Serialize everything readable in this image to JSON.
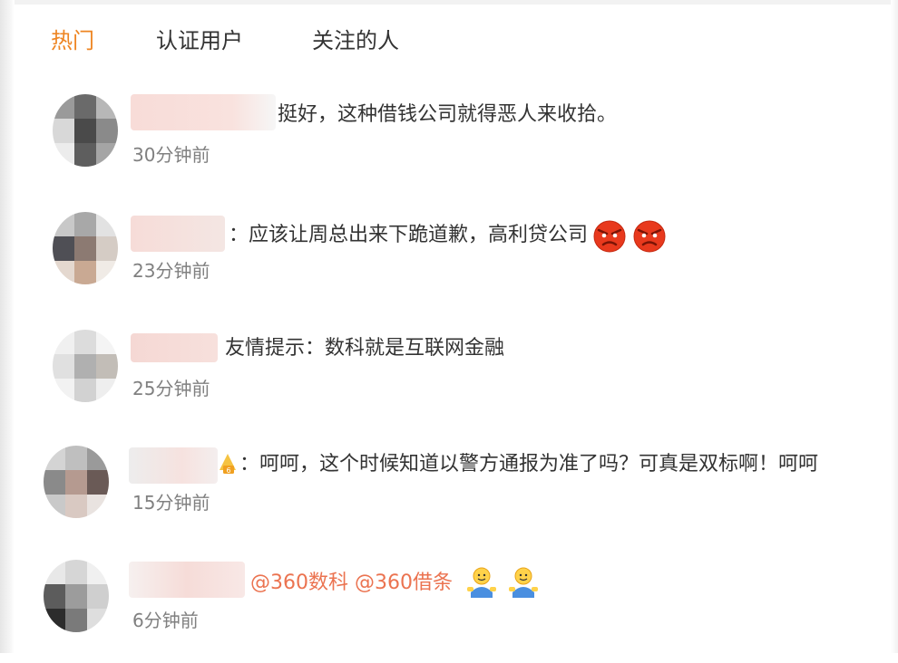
{
  "tabs": [
    {
      "label": "热门",
      "active": true
    },
    {
      "label": "认证用户",
      "active": false
    },
    {
      "label": "关注的人",
      "active": false
    }
  ],
  "comments": [
    {
      "text": "挺好，这种借钱公司就得恶人来收拾。",
      "time": "30分钟前"
    },
    {
      "text": "：应该让周总出来下跪道歉，高利贷公司",
      "emojis": [
        "angry-face-emoji",
        "angry-face-emoji"
      ],
      "time": "23分钟前"
    },
    {
      "text": "友情提示：数科就是互联网金融",
      "time": "25分钟前"
    },
    {
      "text": "：呵呵，这个时候知道以警方通报为准了吗？可真是双标啊！呵呵",
      "time": "15分钟前"
    },
    {
      "mentions": [
        "@360数科",
        "@360借条"
      ],
      "emojis": [
        "figure-emoji",
        "figure-emoji"
      ],
      "time": "6分钟前"
    }
  ],
  "colors": {
    "active_tab": "#ee8522",
    "mention": "#eb7350",
    "time": "#808080",
    "text": "#333333"
  }
}
